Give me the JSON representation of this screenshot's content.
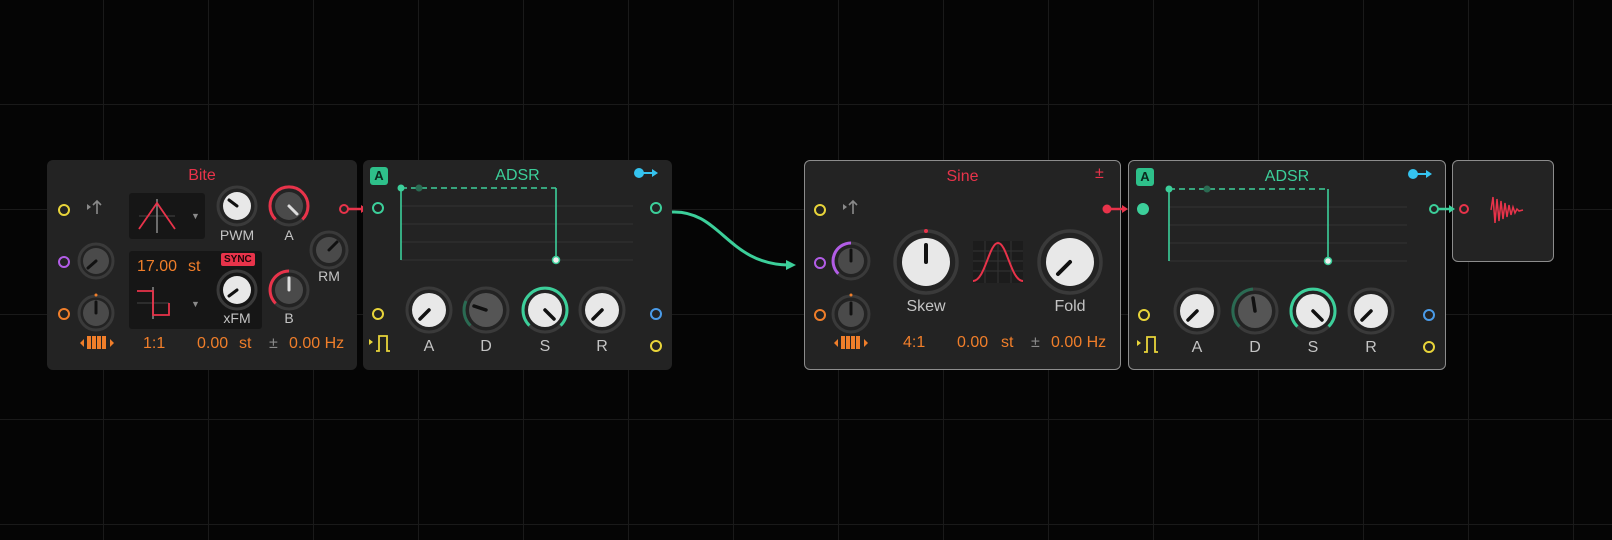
{
  "modules": {
    "bite": {
      "title": "Bite",
      "knobs": {
        "pwm": "PWM",
        "a": "A",
        "rm": "RM",
        "xfm": "xFM",
        "b": "B"
      },
      "pitch": "17.00",
      "pitch_unit": "st",
      "sync": "SYNC",
      "ratio": "1:1",
      "offset": "0.00",
      "offset_unit": "st",
      "plusminus": "±",
      "freq": "0.00 Hz"
    },
    "adsr1": {
      "badge": "A",
      "title": "ADSR",
      "knobs": {
        "a": "A",
        "d": "D",
        "s": "S",
        "r": "R"
      }
    },
    "sine": {
      "title": "Sine",
      "plusminus": "±",
      "knobs": {
        "skew": "Skew",
        "fold": "Fold"
      },
      "ratio": "4:1",
      "offset": "0.00",
      "offset_unit": "st",
      "freq_pm": "±",
      "freq": "0.00 Hz"
    },
    "adsr2": {
      "badge": "A",
      "title": "ADSR",
      "knobs": {
        "a": "A",
        "d": "D",
        "s": "S",
        "r": "R"
      }
    },
    "output": {
      "icon": "waveform-decay-icon"
    }
  },
  "colors": {
    "background": "#050505",
    "module": "#232323",
    "red": "#e8334a",
    "green": "#3ccf9a",
    "orange": "#f07e2a",
    "yellow": "#e8d43a",
    "purple": "#b25ce6",
    "blue": "#4a9be8",
    "cyan": "#35c3ef"
  }
}
